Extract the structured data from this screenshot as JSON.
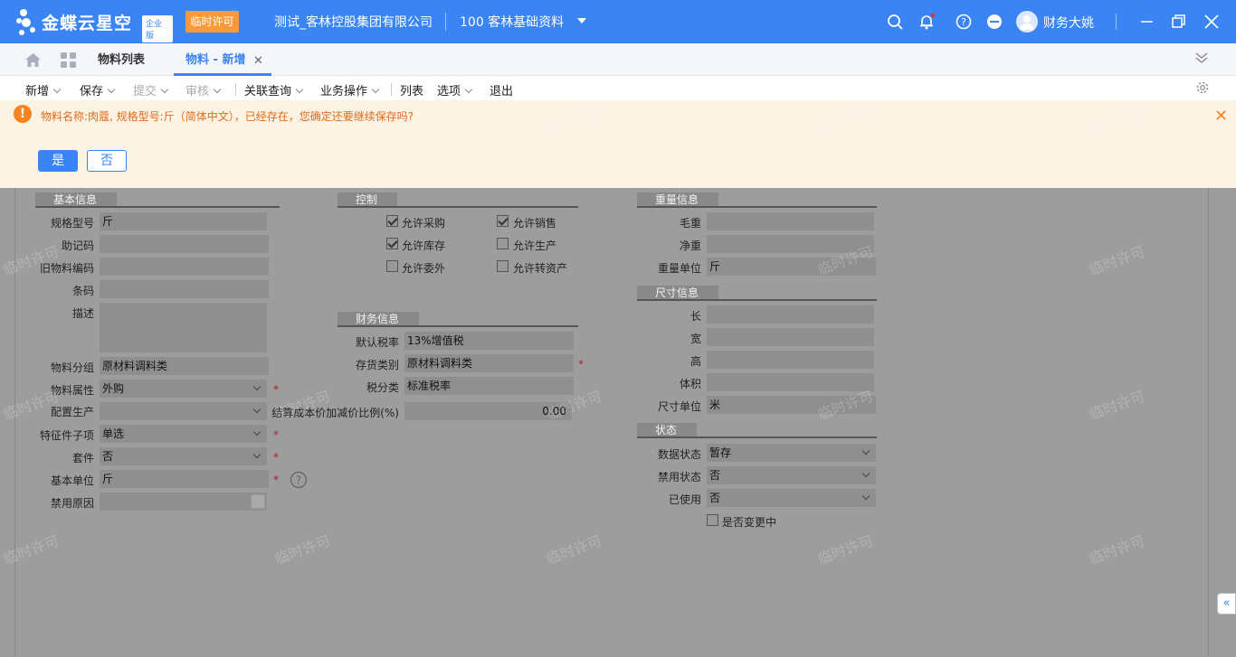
{
  "topbar": {
    "logo_text": "金蝶云星空",
    "logo_badge": "企业版",
    "temp_license": "临时许可",
    "company": "测试_客林控股集团有限公司",
    "org": "100  客林基础资料",
    "user": "财务大姚"
  },
  "tabs": [
    {
      "label": "物料列表"
    },
    {
      "label": "物料 - 新增"
    }
  ],
  "toolbar": {
    "new": "新增",
    "save": "保存",
    "submit": "提交",
    "audit": "审核",
    "related": "关联查询",
    "business": "业务操作",
    "list": "列表",
    "options": "选项",
    "exit": "退出"
  },
  "banner": {
    "message": "物料名称:肉蔻, 规格型号:斤（简体中文），已经存在，您确定还要继续保存吗?",
    "yes": "是",
    "no": "否"
  },
  "basic": {
    "title": "基本信息",
    "spec_label": "规格型号",
    "spec_value": "斤",
    "mnemonic_label": "助记码",
    "old_code_label": "旧物料编码",
    "barcode_label": "条码",
    "desc_label": "描述",
    "group_label": "物料分组",
    "group_value": "原材料调料类",
    "attr_label": "物料属性",
    "attr_value": "外购",
    "config_label": "配置生产",
    "feature_label": "特征件子项",
    "feature_value": "单选",
    "kit_label": "套件",
    "kit_value": "否",
    "unit_label": "基本单位",
    "unit_value": "斤",
    "forbid_reason_label": "禁用原因"
  },
  "control": {
    "title": "控制",
    "allow_purchase": "允许采购",
    "allow_sale": "允许销售",
    "allow_stock": "允许库存",
    "allow_produce": "允许生产",
    "allow_outsource": "允许委外",
    "allow_asset": "允许转资产"
  },
  "finance": {
    "title": "财务信息",
    "tax_rate_label": "默认税率",
    "tax_rate_value": "13%增值税",
    "stock_cat_label": "存货类别",
    "stock_cat_value": "原材料调料类",
    "tax_class_label": "税分类",
    "tax_class_value": "标准税率",
    "markup_label": "结算成本价加减价比例(%)",
    "markup_value": "0.00"
  },
  "weight": {
    "title": "重量信息",
    "gross_label": "毛重",
    "net_label": "净重",
    "unit_label": "重量单位",
    "unit_value": "斤"
  },
  "size": {
    "title": "尺寸信息",
    "length_label": "长",
    "width_label": "宽",
    "height_label": "高",
    "volume_label": "体积",
    "unit_label": "尺寸单位",
    "unit_value": "米"
  },
  "status": {
    "title": "状态",
    "data_label": "数据状态",
    "data_value": "暂存",
    "forbid_label": "禁用状态",
    "forbid_value": "否",
    "used_label": "已使用",
    "used_value": "否",
    "changing_label": "是否变更中"
  },
  "watermark": "临时许可",
  "colors": {
    "brand": "#3a84f4",
    "warning": "#f5831f",
    "temp_badge": "#f89a3a"
  }
}
